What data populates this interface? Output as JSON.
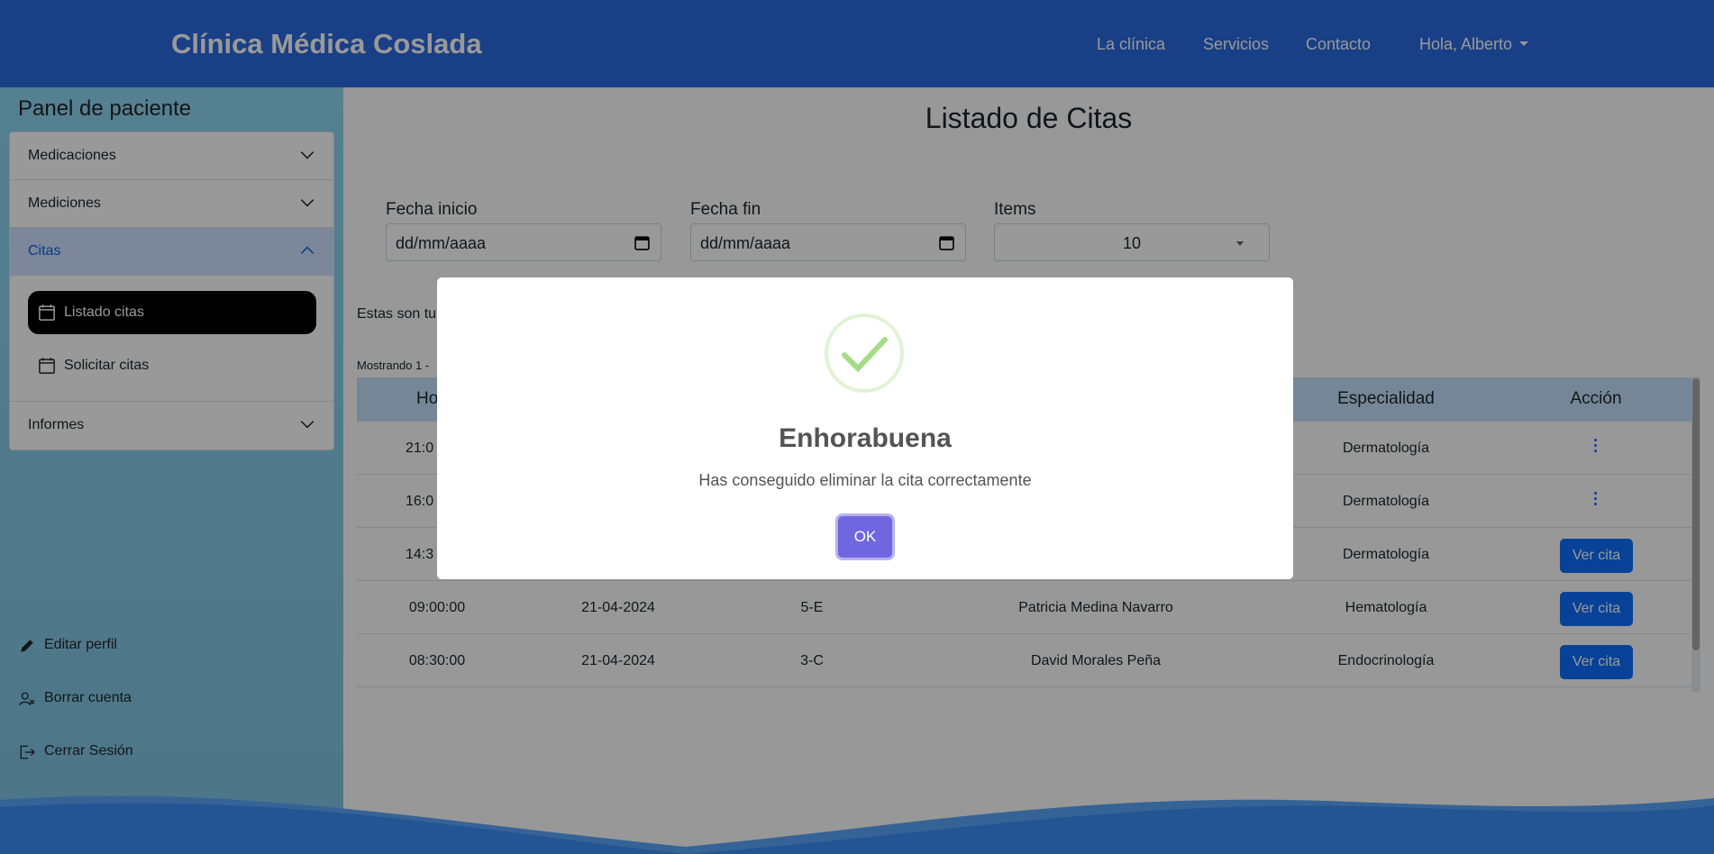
{
  "navbar": {
    "brand": "Clínica Médica Coslada",
    "links": [
      "La clínica",
      "Servicios",
      "Contacto"
    ],
    "user_menu": "Hola, Alberto"
  },
  "sidebar": {
    "title": "Panel de paciente",
    "sections": [
      {
        "label": "Medicaciones",
        "expanded": false
      },
      {
        "label": "Mediciones",
        "expanded": false
      },
      {
        "label": "Citas",
        "expanded": true,
        "items": [
          {
            "label": "Listado citas",
            "selected": true,
            "icon": "calendar-icon"
          },
          {
            "label": "Solicitar citas",
            "selected": false,
            "icon": "calendar-icon"
          }
        ]
      },
      {
        "label": "Informes",
        "expanded": false
      }
    ],
    "bottom_links": [
      {
        "label": "Editar perfil",
        "icon": "pencil-icon"
      },
      {
        "label": "Borrar cuenta",
        "icon": "user-remove-icon"
      },
      {
        "label": "Cerrar Sesión",
        "icon": "logout-icon"
      }
    ]
  },
  "main": {
    "title": "Listado de Citas",
    "filters": {
      "start_label": "Fecha inicio",
      "start_value": "dd/mm/aaaa",
      "end_label": "Fecha fin",
      "end_value": "dd/mm/aaaa",
      "items_label": "Items",
      "items_value": "10"
    },
    "intro_visible": "Estas son tu",
    "showing_visible": "Mostrando 1 -",
    "columns": {
      "hora_visible": "Ho",
      "especialidad": "Especialidad",
      "accion": "Acción"
    },
    "rows": [
      {
        "hora": "21:0",
        "fecha": "",
        "sala": "",
        "medico": "",
        "especialidad": "Dermatología",
        "accion": "menu"
      },
      {
        "hora": "16:0",
        "fecha": "",
        "sala": "",
        "medico": "",
        "especialidad": "Dermatología",
        "accion": "menu"
      },
      {
        "hora": "14:3",
        "fecha": "",
        "sala": "",
        "medico": "",
        "especialidad": "Dermatología",
        "accion": "Ver cita"
      },
      {
        "hora": "09:00:00",
        "fecha": "21-04-2024",
        "sala": "5-E",
        "medico": "Patricia Medina Navarro",
        "especialidad": "Hematología",
        "accion": "Ver cita"
      },
      {
        "hora": "08:30:00",
        "fecha": "21-04-2024",
        "sala": "3-C",
        "medico": "David Morales Peña",
        "especialidad": "Endocrinología",
        "accion": "Ver cita"
      }
    ]
  },
  "modal": {
    "title": "Enhorabuena",
    "text": "Has conseguido eliminar la cita correctamente",
    "ok_label": "OK",
    "icon": "success-check-icon"
  },
  "colors": {
    "navbar": "#2a6adf",
    "sidebar": "#8ed5f2",
    "header_row": "#c3e1fb",
    "button": "#0d6efd",
    "ok_button": "#7066e0",
    "success": "#a5dc86"
  }
}
